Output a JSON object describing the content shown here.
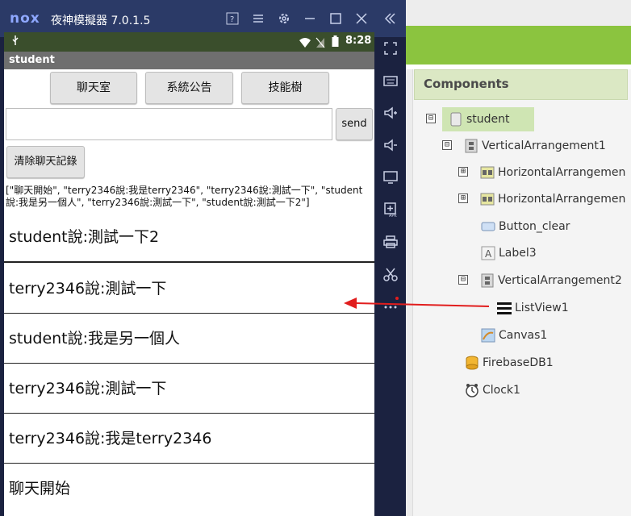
{
  "emulator": {
    "logo": "nox",
    "title": "夜神模擬器 7.0.1.5",
    "status_time": "8:28",
    "status_left_icon": "usb-icon",
    "app_title": "student"
  },
  "app": {
    "tabs": [
      "聊天室",
      "系統公告",
      "技能樹"
    ],
    "input_value": "",
    "send_label": "send",
    "clear_label": "清除聊天記錄",
    "label3": "[\"聊天開始\", \"terry2346說:我是terry2346\", \"terry2346說:測試一下\", \"student說:我是另一個人\", \"terry2346說:測試一下\", \"student說:測試一下2\"]",
    "list_items": [
      "student說:測試一下2",
      "terry2346說:測試一下",
      "student說:我是另一個人",
      "terry2346說:測試一下",
      "terry2346說:我是terry2346",
      "聊天開始"
    ]
  },
  "components": {
    "title": "Components",
    "tree": [
      {
        "label": "student",
        "toggle": "⊟",
        "icon": "screen-icon"
      },
      {
        "label": "VerticalArrangement1",
        "toggle": "⊟",
        "icon": "vertical-arrangement-icon"
      },
      {
        "label": "HorizontalArrangemen",
        "toggle": "⊞",
        "icon": "horizontal-arrangement-icon"
      },
      {
        "label": "HorizontalArrangemen",
        "toggle": "⊞",
        "icon": "horizontal-arrangement-icon"
      },
      {
        "label": "Button_clear",
        "toggle": "",
        "icon": "button-icon"
      },
      {
        "label": "Label3",
        "toggle": "",
        "icon": "label-icon"
      },
      {
        "label": "VerticalArrangement2",
        "toggle": "⊟",
        "icon": "vertical-arrangement-icon"
      },
      {
        "label": "ListView1",
        "toggle": "",
        "icon": "listview-icon"
      },
      {
        "label": "Canvas1",
        "toggle": "",
        "icon": "canvas-icon"
      },
      {
        "label": "FirebaseDB1",
        "toggle": "",
        "icon": "firebase-icon"
      },
      {
        "label": "Clock1",
        "toggle": "",
        "icon": "clock-icon"
      }
    ]
  },
  "colors": {
    "emulator_title": "#2b3a67",
    "emulator_side": "#1b2240",
    "statusbar": "#3a4e2c",
    "ide_green": "#8bc43f",
    "component_header": "#dbe8c4",
    "arrow": "#e11d1d"
  }
}
